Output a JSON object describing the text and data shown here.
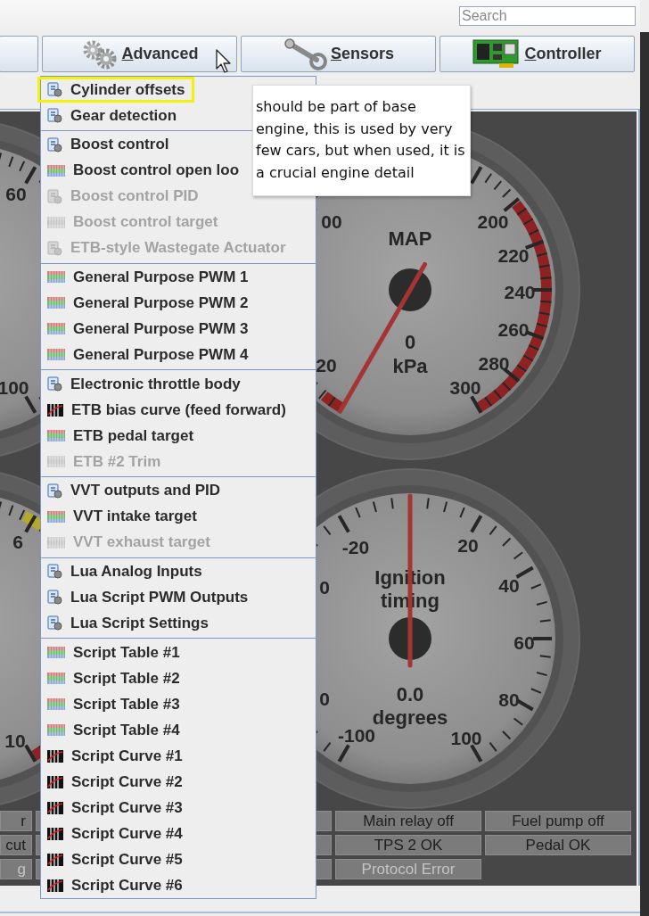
{
  "search": {
    "placeholder": "Search"
  },
  "toolbar": [
    {
      "kind": "partial"
    },
    {
      "kind": "gears",
      "label": "Advanced"
    },
    {
      "kind": "rod",
      "label": "Sensors"
    },
    {
      "kind": "board",
      "label": "Controller"
    }
  ],
  "dashboard": {
    "gauges": [
      {
        "kind": "left_top",
        "labels": [
          "60",
          "100"
        ]
      },
      {
        "kind": "map",
        "title": [
          "MAP"
        ],
        "value": "0",
        "units": "kPa",
        "labels": [
          "00",
          "20",
          "200",
          "220",
          "240",
          "260",
          "280",
          "300"
        ]
      },
      {
        "kind": "left_bottom",
        "labels": [
          "6",
          "10"
        ]
      },
      {
        "kind": "ignition",
        "title": [
          "Ignition",
          "timing"
        ],
        "value": "0.0",
        "units": "degrees",
        "labels": [
          "-20",
          "20",
          "40",
          "60",
          "80",
          "100",
          "-100",
          "0",
          "0"
        ]
      }
    ],
    "indicators": [
      {
        "cells": [
          {
            "kind": "text",
            "text": "r",
            "enabled": true
          },
          {
            "kind": "blank"
          },
          {
            "kind": "blank"
          },
          {
            "kind": "text",
            "text": "Main relay off",
            "enabled": true
          },
          {
            "kind": "text",
            "text": "Fuel pump off",
            "enabled": true
          }
        ]
      },
      {
        "cells": [
          {
            "kind": "text",
            "text": "cut",
            "enabled": true
          },
          {
            "kind": "blank"
          },
          {
            "kind": "blank"
          },
          {
            "kind": "text",
            "text": "TPS 2 OK",
            "enabled": true
          },
          {
            "kind": "text",
            "text": "Pedal OK",
            "enabled": true
          }
        ]
      },
      {
        "cells": [
          {
            "kind": "text",
            "text": "g",
            "enabled": false
          },
          {
            "kind": "blank"
          },
          {
            "kind": "blank"
          },
          {
            "kind": "text",
            "text": "Protocol Error",
            "enabled": false
          }
        ]
      }
    ]
  },
  "menu": {
    "groups": [
      {
        "items": [
          {
            "label": "Cylinder offsets",
            "kind": "dialog",
            "enabled": true,
            "selected": true
          },
          {
            "label": "Gear detection",
            "kind": "dialog",
            "enabled": true,
            "selected": false
          }
        ]
      },
      {
        "items": [
          {
            "label": "Boost control",
            "kind": "dialog",
            "enabled": true,
            "selected": false
          },
          {
            "label": "Boost control open loo",
            "kind": "table",
            "enabled": true,
            "selected": false
          },
          {
            "label": "Boost control PID",
            "kind": "dialog",
            "enabled": false,
            "selected": false
          },
          {
            "label": "Boost control target",
            "kind": "table",
            "enabled": false,
            "selected": false
          },
          {
            "label": "ETB-style Wastegate Actuator",
            "kind": "dialog",
            "enabled": false,
            "selected": false
          }
        ]
      },
      {
        "items": [
          {
            "label": "General Purpose PWM 1",
            "kind": "table",
            "enabled": true,
            "selected": false
          },
          {
            "label": "General Purpose PWM 2",
            "kind": "table",
            "enabled": true,
            "selected": false
          },
          {
            "label": "General Purpose PWM 3",
            "kind": "table",
            "enabled": true,
            "selected": false
          },
          {
            "label": "General Purpose PWM 4",
            "kind": "table",
            "enabled": true,
            "selected": false
          }
        ]
      },
      {
        "items": [
          {
            "label": "Electronic throttle body",
            "kind": "dialog",
            "enabled": true,
            "selected": false
          },
          {
            "label": "ETB bias curve (feed forward)",
            "kind": "curve",
            "enabled": true,
            "selected": false
          },
          {
            "label": "ETB pedal target",
            "kind": "table",
            "enabled": true,
            "selected": false
          },
          {
            "label": "ETB #2 Trim",
            "kind": "table",
            "enabled": false,
            "selected": false
          }
        ]
      },
      {
        "items": [
          {
            "label": "VVT outputs and PID",
            "kind": "dialog",
            "enabled": true,
            "selected": false
          },
          {
            "label": "VVT intake target",
            "kind": "table",
            "enabled": true,
            "selected": false
          },
          {
            "label": "VVT exhaust target",
            "kind": "table",
            "enabled": false,
            "selected": false
          }
        ]
      },
      {
        "items": [
          {
            "label": "Lua Analog Inputs",
            "kind": "dialog",
            "enabled": true,
            "selected": false
          },
          {
            "label": "Lua Script PWM Outputs",
            "kind": "dialog",
            "enabled": true,
            "selected": false
          },
          {
            "label": "Lua Script Settings",
            "kind": "dialog",
            "enabled": true,
            "selected": false
          }
        ]
      },
      {
        "items": [
          {
            "label": "Script Table #1",
            "kind": "table",
            "enabled": true,
            "selected": false
          },
          {
            "label": "Script Table #2",
            "kind": "table",
            "enabled": true,
            "selected": false
          },
          {
            "label": "Script Table #3",
            "kind": "table",
            "enabled": true,
            "selected": false
          },
          {
            "label": "Script Table #4",
            "kind": "table",
            "enabled": true,
            "selected": false
          },
          {
            "label": "Script Curve #1",
            "kind": "curve",
            "enabled": true,
            "selected": false
          },
          {
            "label": "Script Curve #2",
            "kind": "curve",
            "enabled": true,
            "selected": false
          },
          {
            "label": "Script Curve #3",
            "kind": "curve",
            "enabled": true,
            "selected": false
          },
          {
            "label": "Script Curve #4",
            "kind": "curve",
            "enabled": true,
            "selected": false
          },
          {
            "label": "Script Curve #5",
            "kind": "curve",
            "enabled": true,
            "selected": false
          },
          {
            "label": "Script Curve #6",
            "kind": "curve",
            "enabled": true,
            "selected": false
          }
        ]
      }
    ]
  },
  "tooltip": {
    "text": "should be part of base engine, this is used by very few cars, but when used, it is a crucial engine detail"
  }
}
